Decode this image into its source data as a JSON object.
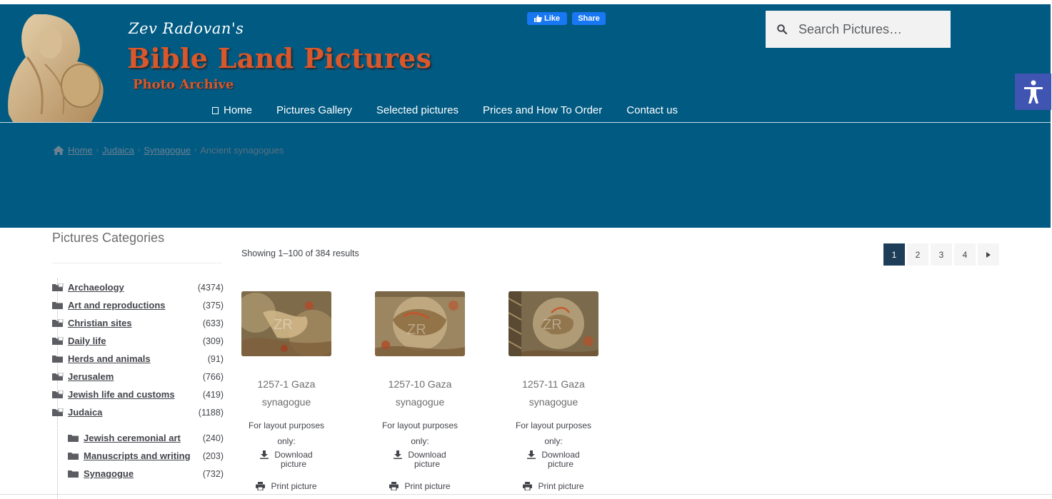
{
  "header": {
    "logo_line1": "Zev Radovan's",
    "logo_main": "Bible Land Pictures",
    "logo_line2": "Photo Archive",
    "fb_like": "Like",
    "fb_share": "Share",
    "search_placeholder": "Search Pictures…"
  },
  "nav": {
    "items": [
      "Home",
      "Pictures Gallery",
      "Selected pictures",
      "Prices and How To Order",
      "Contact us"
    ]
  },
  "breadcrumb": {
    "items": [
      "Home",
      "Judaica",
      "Synagogue"
    ],
    "current": "Ancient synagogues"
  },
  "sidebar": {
    "title": "Pictures Categories",
    "categories": [
      {
        "label": "Archaeology",
        "count": "(4374)"
      },
      {
        "label": "Art and reproductions",
        "count": "(375)"
      },
      {
        "label": "Christian sites",
        "count": "(633)"
      },
      {
        "label": "Daily life",
        "count": "(309)"
      },
      {
        "label": "Herds and animals",
        "count": "(91)"
      },
      {
        "label": "Jerusalem",
        "count": "(766)"
      },
      {
        "label": "Jewish life and customs",
        "count": "(419)"
      },
      {
        "label": "Judaica",
        "count": "(1188)"
      }
    ],
    "subcategories": [
      {
        "label": "Jewish ceremonial art",
        "count": "(240)"
      },
      {
        "label": "Manuscripts and writing",
        "count": "(203)"
      },
      {
        "label": "Synagogue",
        "count": "(732)"
      }
    ]
  },
  "results": {
    "text": "Showing 1–100 of 384 results"
  },
  "pagination": {
    "pages": [
      "1",
      "2",
      "3",
      "4"
    ],
    "active": "1"
  },
  "products": [
    {
      "name1": "1257-1 Gaza",
      "name2": "synagogue",
      "note1": "For layout purposes",
      "note2": "only:",
      "download1": "Download",
      "download2": "picture",
      "print": "Print picture"
    },
    {
      "name1": "1257-10 Gaza",
      "name2": "synagogue",
      "note1": "For layout purposes",
      "note2": "only:",
      "download1": "Download",
      "download2": "picture",
      "print": "Print picture"
    },
    {
      "name1": "1257-11 Gaza",
      "name2": "synagogue",
      "note1": "For layout purposes",
      "note2": "only:",
      "download1": "Download",
      "download2": "picture",
      "print": "Print picture"
    }
  ],
  "colors": {
    "header_bg": "#005a82",
    "logo_orange": "#d9572a",
    "accessibility_bg": "#4054b2",
    "pager_active": "#1e3d58"
  }
}
